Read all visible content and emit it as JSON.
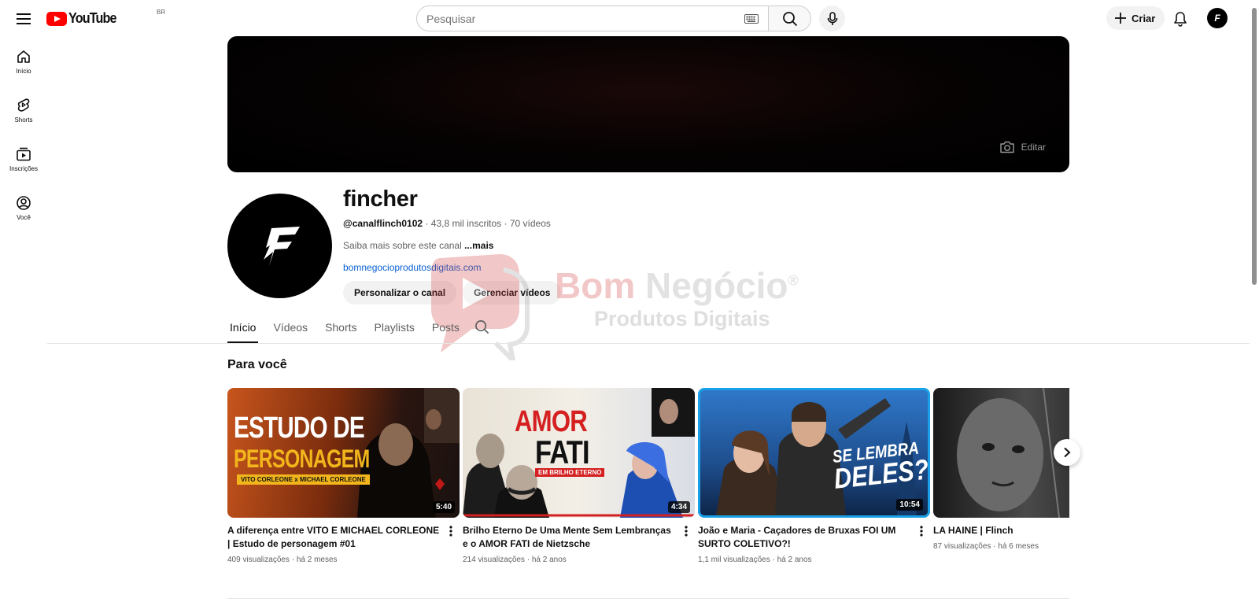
{
  "header": {
    "logo_text": "YouTube",
    "country_code": "BR",
    "search_placeholder": "Pesquisar",
    "create_label": "Criar",
    "avatar_letter": "F"
  },
  "sidebar": {
    "items": [
      {
        "label": "Início",
        "icon": "home-icon"
      },
      {
        "label": "Shorts",
        "icon": "shorts-icon"
      },
      {
        "label": "Inscrições",
        "icon": "subscriptions-icon"
      },
      {
        "label": "Você",
        "icon": "you-icon"
      }
    ]
  },
  "banner": {
    "edit_label": "Editar"
  },
  "channel": {
    "name": "fincher",
    "handle": "@canalflinch0102",
    "subscribers": "43,8 mil inscritos",
    "video_count": "70 vídeos",
    "description": "Saiba mais sobre este canal",
    "more_label": "...mais",
    "link": "bomnegocioprodutosdigitais.com",
    "customize_label": "Personalizar o canal",
    "manage_label": "Gerenciar vídeos"
  },
  "tabs": [
    "Início",
    "Vídeos",
    "Shorts",
    "Playlists",
    "Posts"
  ],
  "section": {
    "title": "Para você"
  },
  "videos": [
    {
      "title": "A diferença entre VITO E MICHAEL CORLEONE | Estudo de personagem #01",
      "views": "409 visualizações",
      "age": "há 2 meses",
      "duration": "5:40",
      "thumb_line1": "ESTUDO DE",
      "thumb_line2": "PERSONAGEM",
      "thumb_line3": "VITO CORLEONE x MICHAEL CORLEONE"
    },
    {
      "title": "Brilho Eterno De Uma Mente Sem Lembranças e o AMOR FATI de Nietzsche",
      "views": "214 visualizações",
      "age": "há 2 anos",
      "duration": "4:34",
      "thumb_line1": "AMOR",
      "thumb_line2": "FATI",
      "thumb_line3": "EM BRILHO ETERNO"
    },
    {
      "title": "João e Maria - Caçadores de Bruxas FOI UM SURTO COLETIVO?!",
      "views": "1,1 mil visualizações",
      "age": "há 2 anos",
      "duration": "10:54",
      "thumb_line1": "SE LEMBRA",
      "thumb_line2": "DELES?"
    },
    {
      "title": "LA HAINE | Flinch",
      "views": "87 visualizações",
      "age": "há 6 meses"
    }
  ],
  "watermark": {
    "line1_red": "Bom",
    "line1_grey": "Negócio",
    "mark": "®",
    "line2": "Produtos Digitais"
  }
}
